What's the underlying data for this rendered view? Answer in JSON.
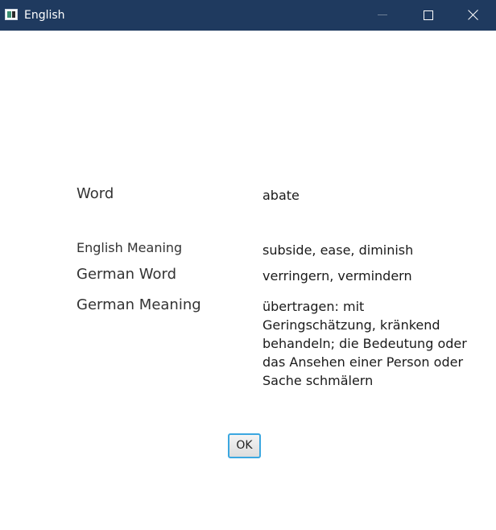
{
  "window": {
    "title": "English"
  },
  "titlebar": {
    "icons": {
      "app": "app-icon",
      "minimize": "minimize-icon",
      "maximize": "maximize-icon",
      "close": "close-icon"
    },
    "colors": {
      "background": "#1f3a5f"
    }
  },
  "fields": {
    "word": {
      "label": "Word",
      "value": "abate"
    },
    "english_meaning": {
      "label": "English Meaning",
      "value": "subside, ease, diminish"
    },
    "german_word": {
      "label": "German Word",
      "value": "verringern, vermindern"
    },
    "german_meaning": {
      "label": "German Meaning",
      "value": "übertragen: mit Geringschätzung, kränkend behandeln; die Bedeutung oder das Ansehen einer Person oder Sache schmälern"
    }
  },
  "actions": {
    "ok_label": "OK"
  },
  "colors": {
    "ok_focus_border": "#3ba7e0"
  }
}
